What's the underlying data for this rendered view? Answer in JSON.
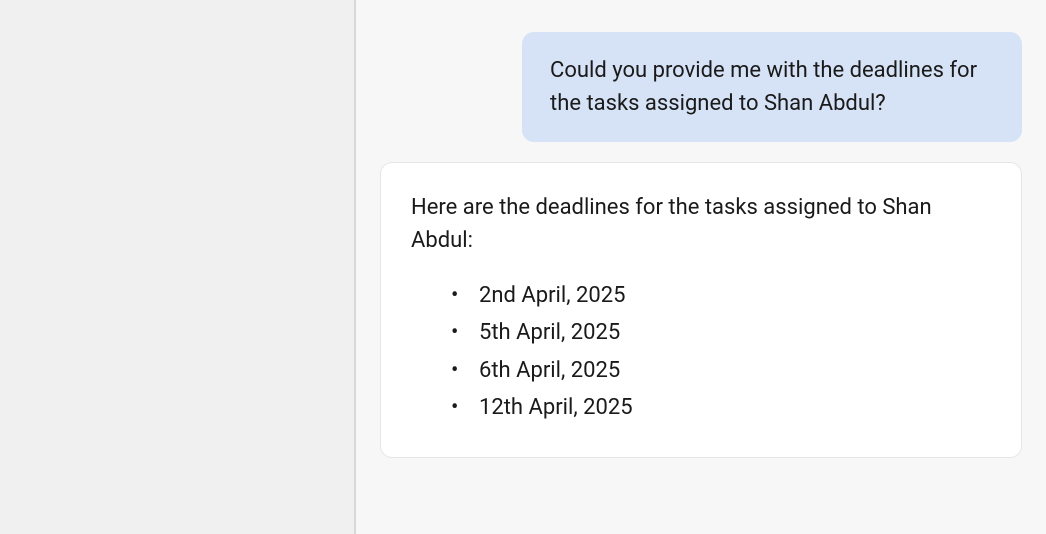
{
  "chat": {
    "user_message": "Could you provide me with the deadlines for the tasks assigned to Shan Abdul?",
    "assistant_intro": "Here are the deadlines for the tasks assigned to Shan Abdul:",
    "deadlines": [
      "2nd April, 2025",
      "5th April, 2025",
      "6th April, 2025",
      "12th April, 2025"
    ]
  }
}
